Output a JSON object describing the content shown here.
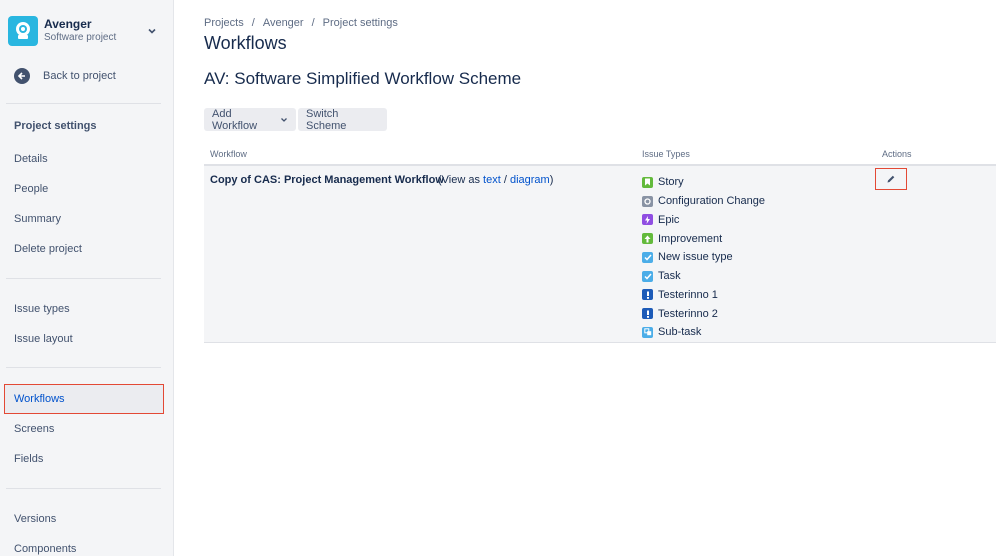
{
  "sidebar": {
    "project_name": "Avenger",
    "project_type": "Software project",
    "back_label": "Back to project",
    "heading": "Project settings",
    "items": [
      {
        "label": "Details"
      },
      {
        "label": "People"
      },
      {
        "label": "Summary"
      },
      {
        "label": "Delete project"
      },
      {
        "label": "Issue types"
      },
      {
        "label": "Issue layout"
      },
      {
        "label": "Workflows",
        "active": true
      },
      {
        "label": "Screens"
      },
      {
        "label": "Fields"
      },
      {
        "label": "Versions"
      },
      {
        "label": "Components"
      }
    ]
  },
  "breadcrumbs": [
    "Projects",
    "Avenger",
    "Project settings"
  ],
  "page_title": "Workflows",
  "scheme_title": "AV: Software Simplified Workflow Scheme",
  "toolbar": {
    "add_workflow": "Add Workflow",
    "switch_scheme": "Switch Scheme"
  },
  "table": {
    "columns": [
      "Workflow",
      "Issue Types",
      "Actions"
    ],
    "rows": [
      {
        "workflow": "Copy of CAS: Project Management Workflow",
        "view_prefix": "(View as",
        "view_text_link": "text",
        "view_sep": "/",
        "view_diagram_link": "diagram",
        "view_suffix": ")",
        "issue_types": [
          {
            "label": "Story",
            "icon": "story-icon",
            "color": "#63ba3c"
          },
          {
            "label": "Configuration Change",
            "icon": "configuration-change-icon",
            "color": "#8993a4"
          },
          {
            "label": "Epic",
            "icon": "epic-icon",
            "color": "#904ee2"
          },
          {
            "label": "Improvement",
            "icon": "improvement-icon",
            "color": "#63ba3c"
          },
          {
            "label": "New issue type",
            "icon": "check-icon",
            "color": "#4bade8"
          },
          {
            "label": "Task",
            "icon": "task-icon",
            "color": "#4bade8"
          },
          {
            "label": "Testerinno 1",
            "icon": "exclamation-icon",
            "color": "#1d5bb8"
          },
          {
            "label": "Testerinno 2",
            "icon": "exclamation-icon",
            "color": "#1d5bb8"
          },
          {
            "label": "Sub-task",
            "icon": "subtask-icon",
            "color": "#4bade8"
          }
        ]
      }
    ]
  },
  "colors": {
    "accent": "#0052cc",
    "highlight_border": "#e34935",
    "sidebar_bg": "#f4f5f7"
  }
}
